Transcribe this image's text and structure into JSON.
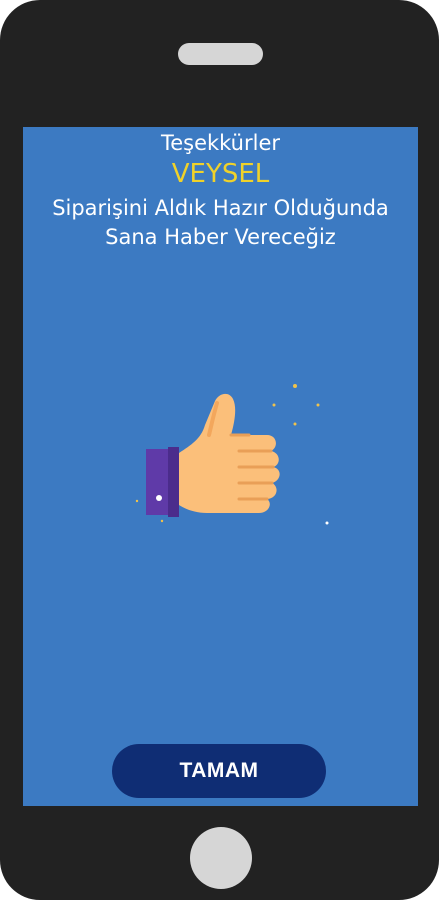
{
  "confirmation": {
    "thanks": "Teşekkürler",
    "customer_name": "VEYSEL",
    "message_line1": "Siparişini Aldık Hazır Olduğunda",
    "message_line2": "Sana Haber Vereceğiz"
  },
  "illustration": {
    "icon": "thumbs-up-icon"
  },
  "actions": {
    "ok_label": "TAMAM"
  },
  "colors": {
    "screen_background": "#3c7ac2",
    "name_accent": "#f0d22a",
    "button_background": "#0f2d74",
    "phone_frame": "#222222"
  }
}
